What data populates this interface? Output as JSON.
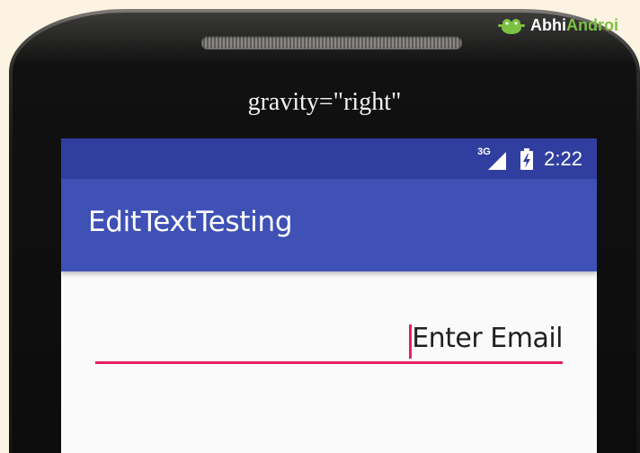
{
  "caption": "gravity=\"right\"",
  "logo": {
    "part1": "Abhi",
    "part2": "Androi"
  },
  "status_bar": {
    "network": "3G",
    "time": "2:22"
  },
  "app": {
    "title": "EditTextTesting"
  },
  "edit_text": {
    "hint": "Enter Email"
  },
  "colors": {
    "status_bar": "#303f9f",
    "toolbar": "#3f51b5",
    "accent": "#e91e63",
    "screen_bg": "#fafafa",
    "logo_green": "#7bc142"
  }
}
